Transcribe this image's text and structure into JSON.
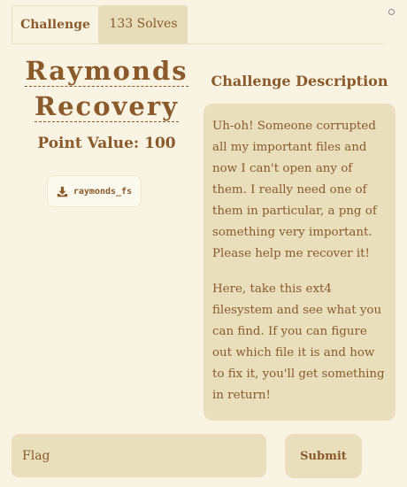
{
  "tabs": {
    "challenge_label": "Challenge",
    "solves_label": "133 Solves"
  },
  "challenge": {
    "title_line1": "Raymonds",
    "title_line2": "Recovery",
    "points": "Point Value: 100",
    "file_name": "raymonds_fs",
    "file_icon": "download-icon"
  },
  "description": {
    "heading": "Challenge Description",
    "paragraph1": "Uh-oh! Someone corrupted all my important files and now I can't open any of them. I really need one of them in particular, a png of something very important. Please help me recover it!",
    "paragraph2": "Here, take this ext4 filesystem and see what you can find. If you can figure out which file it is and how to fix it, you'll get something in return!"
  },
  "form": {
    "flag_placeholder": "Flag",
    "submit_label": "Submit"
  },
  "colors": {
    "background": "#f8f3e2",
    "text": "#8a5a2b",
    "panel": "#e9dfbd"
  }
}
